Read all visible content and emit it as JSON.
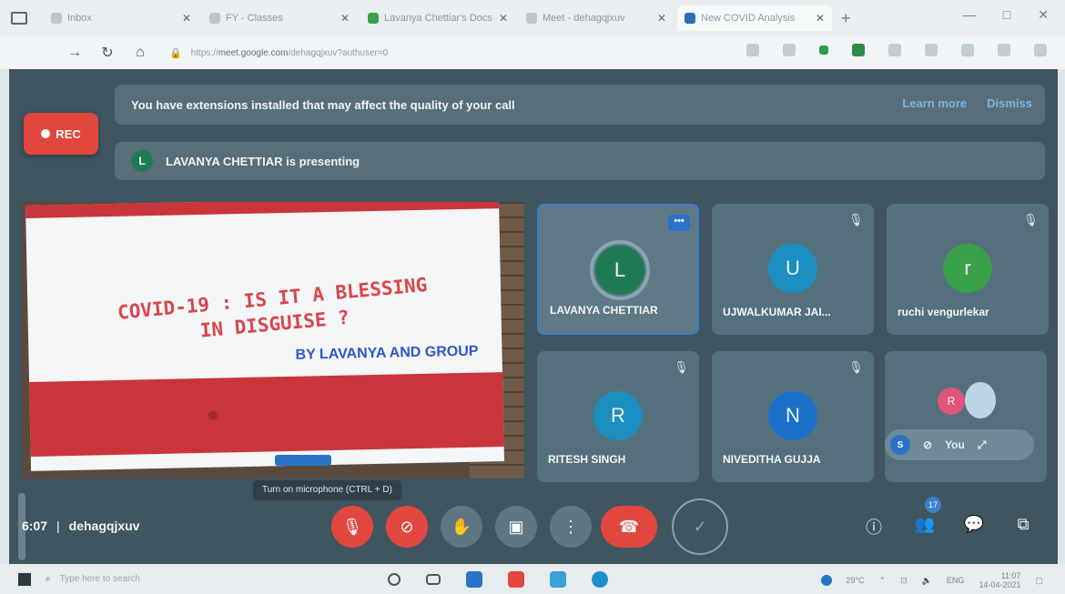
{
  "browser": {
    "tabs": [
      {
        "label": "Inbox"
      },
      {
        "label": "FY - Classes"
      },
      {
        "label": "Lavanya Chettiar's Docs"
      },
      {
        "label": "Meet - dehagqjxuv"
      },
      {
        "label": "New COVID Analysis"
      }
    ],
    "url_prefix": "https://",
    "url_domain": "meet.google.com",
    "url_path": "/dehagqjxuv?authuser=0"
  },
  "notice": {
    "text": "You have extensions installed that may affect the quality of your call",
    "learn_more": "Learn more",
    "dismiss": "Dismiss"
  },
  "rec_label": "REC",
  "presenting": {
    "initial": "L",
    "text": "LAVANYA CHETTIAR is presenting"
  },
  "slide": {
    "title_line1": "COVID-19 : IS IT A BLESSING",
    "title_line2": "IN DISGUISE ?",
    "byline": "BY LAVANYA AND GROUP"
  },
  "participants": [
    {
      "name": "LAVANYA CHETTIAR",
      "initial": "L",
      "color": "#1d7a55"
    },
    {
      "name": "UJWALKUMAR JAI...",
      "initial": "U",
      "color": "#1b8fc0"
    },
    {
      "name": "ruchi vengurlekar",
      "initial": "r",
      "color": "#3aa04a"
    },
    {
      "name": "RITESH SINGH",
      "initial": "R",
      "color": "#1b8fc0"
    },
    {
      "name": "NIVEDITHA GUJJA",
      "initial": "N",
      "color": "#1c6fc9"
    }
  ],
  "self_tile": {
    "mini_initial": "R",
    "pill_initial": "S",
    "label": "You"
  },
  "tooltip": "Turn on microphone (CTRL + D)",
  "meeting": {
    "time": "6:07",
    "code": "dehagqjxuv",
    "participant_count": "17"
  },
  "taskbar": {
    "search_placeholder": "Type here to search",
    "temperature": "29°C",
    "language": "ENG",
    "time": "11:07",
    "date": "14-04-2021"
  }
}
